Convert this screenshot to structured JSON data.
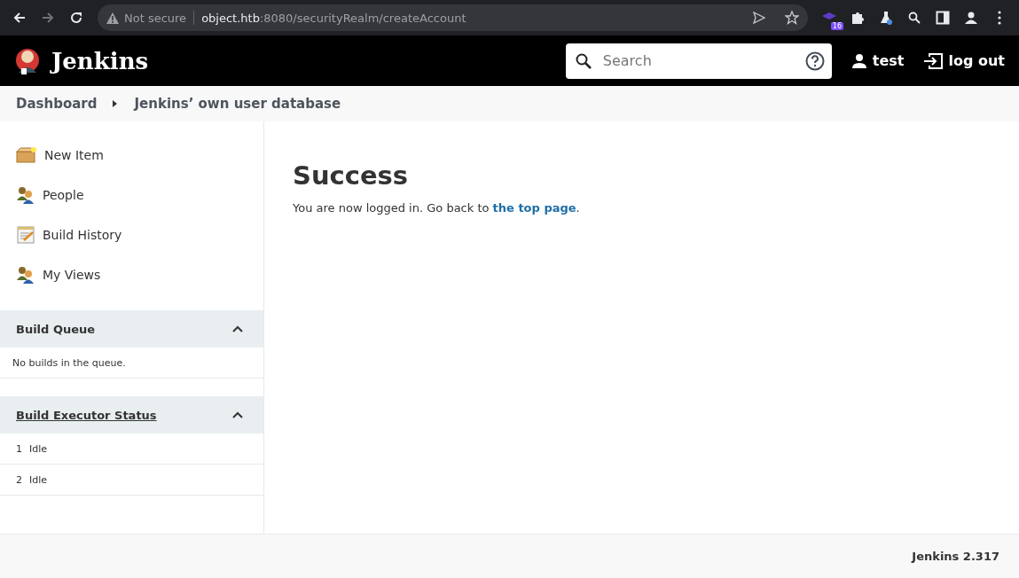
{
  "browser": {
    "back_disabled": false,
    "forward_disabled": true,
    "security": "Not secure",
    "url_host": "object.htb",
    "url_rest": ":8080/securityRealm/createAccount",
    "extension_badge": "16"
  },
  "header": {
    "title": "Jenkins",
    "search": {
      "placeholder": "Search"
    },
    "user": "test",
    "logout": "log out"
  },
  "breadcrumb": [
    "Dashboard",
    "Jenkins’ own user database"
  ],
  "tasks": [
    {
      "kind": "new-item",
      "label": "New Item"
    },
    {
      "kind": "people",
      "label": "People"
    },
    {
      "kind": "history",
      "label": "Build History"
    },
    {
      "kind": "views",
      "label": "My Views"
    }
  ],
  "build_queue": {
    "title": "Build Queue",
    "expanded": true,
    "message": "No builds in the queue."
  },
  "executors": {
    "title": "Build Executor Status",
    "expanded": true,
    "rows": [
      {
        "number": "1",
        "status": "Idle"
      },
      {
        "number": "2",
        "status": "Idle"
      }
    ]
  },
  "main": {
    "heading": "Success",
    "text_before": "You are now logged in. Go back to ",
    "link": "the top page",
    "text_after": "."
  },
  "footer": {
    "version": "Jenkins 2.317"
  }
}
